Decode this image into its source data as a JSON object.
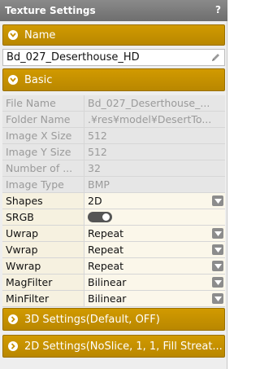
{
  "panel": {
    "title": "Texture Settings",
    "help": "?"
  },
  "sections": {
    "name": "Name",
    "basic": "Basic",
    "settings3d": "3D Settings(Default, OFF)",
    "settings2d": "2D Settings(NoSlice, 1, 1, Fill Streat..."
  },
  "name_value": "Bd_027_Deserthouse_HD",
  "readonly": [
    {
      "label": "File Name",
      "value": "Bd_027_Deserthouse_..."
    },
    {
      "label": "Folder Name",
      "value": ".¥res¥model¥DesertTo..."
    },
    {
      "label": "Image X Size",
      "value": "512"
    },
    {
      "label": "Image Y Size",
      "value": "512"
    },
    {
      "label": "Number of ...",
      "value": "32"
    },
    {
      "label": "Image Type",
      "value": "BMP"
    }
  ],
  "editable": {
    "shapes": {
      "label": "Shapes",
      "value": "2D"
    },
    "srgb": {
      "label": "SRGB",
      "state": "on"
    },
    "uwrap": {
      "label": "Uwrap",
      "value": "Repeat"
    },
    "vwrap": {
      "label": "Vwrap",
      "value": "Repeat"
    },
    "wwrap": {
      "label": "Wwrap",
      "value": "Repeat"
    },
    "magfilter": {
      "label": "MagFilter",
      "value": "Bilinear"
    },
    "minfilter": {
      "label": "MinFilter",
      "value": "Bilinear"
    }
  },
  "colors": {
    "section": "#c99100",
    "titlebar": "#7b7b7b"
  },
  "icons": {
    "section_toggle": "chevron-circle-icon",
    "edit": "pencil-icon",
    "dropdown": "chevron-down-icon"
  }
}
